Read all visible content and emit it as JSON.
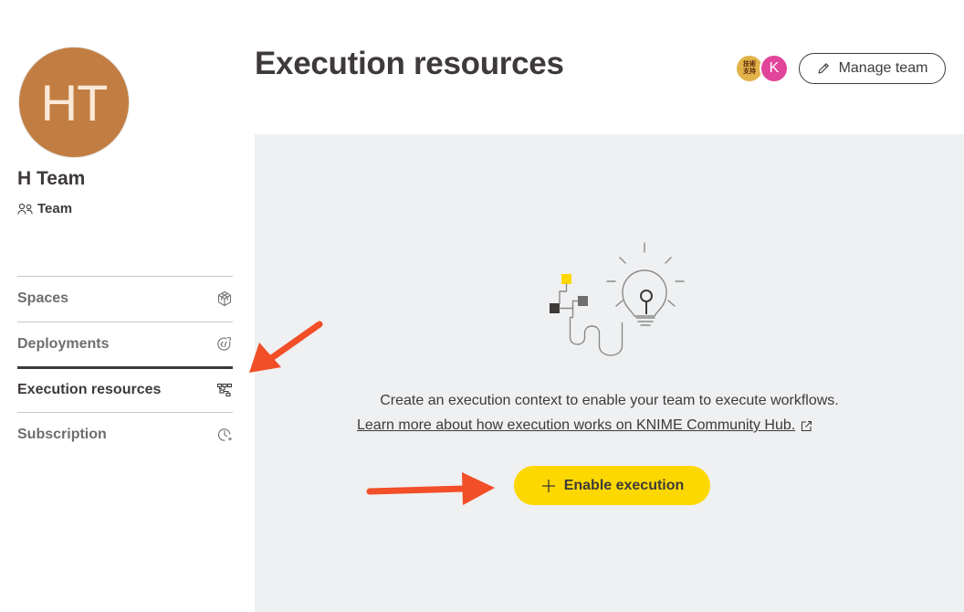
{
  "team": {
    "initials": "HT",
    "name": "H Team",
    "type_label": "Team",
    "avatar_color": "#c27e42"
  },
  "sidebar": {
    "items": [
      {
        "label": "Spaces",
        "icon": "spaces-cube-icon",
        "active": false
      },
      {
        "label": "Deployments",
        "icon": "deployments-icon",
        "active": false
      },
      {
        "label": "Execution resources",
        "icon": "execution-resources-icon",
        "active": true
      },
      {
        "label": "Subscription",
        "icon": "subscription-clock-icon",
        "active": false
      }
    ]
  },
  "header": {
    "title": "Execution resources",
    "members": [
      {
        "initial": "技術\n支持",
        "color": "#e2b349"
      },
      {
        "initial": "K",
        "color": "#e0459a"
      }
    ],
    "manage_label": "Manage team"
  },
  "main": {
    "description": "Create an execution context to enable your team to execute workflows.",
    "link_text": "Learn more about how execution works on KNIME Community Hub.",
    "enable_label": "Enable execution",
    "accent_color": "#fdd800",
    "panel_color": "#eff0f2"
  },
  "annotations": {
    "arrow_color": "#f24e27"
  }
}
